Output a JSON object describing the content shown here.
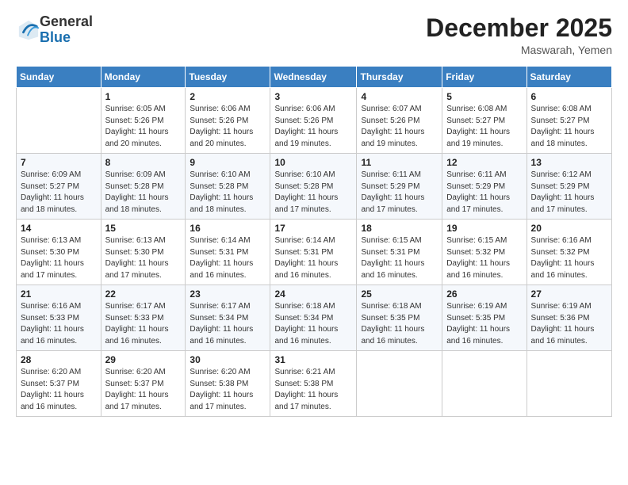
{
  "logo": {
    "line1": "General",
    "line2": "Blue"
  },
  "title": "December 2025",
  "location": "Maswarah, Yemen",
  "days_of_week": [
    "Sunday",
    "Monday",
    "Tuesday",
    "Wednesday",
    "Thursday",
    "Friday",
    "Saturday"
  ],
  "weeks": [
    [
      {
        "day": "",
        "info": ""
      },
      {
        "day": "1",
        "info": "Sunrise: 6:05 AM\nSunset: 5:26 PM\nDaylight: 11 hours\nand 20 minutes."
      },
      {
        "day": "2",
        "info": "Sunrise: 6:06 AM\nSunset: 5:26 PM\nDaylight: 11 hours\nand 20 minutes."
      },
      {
        "day": "3",
        "info": "Sunrise: 6:06 AM\nSunset: 5:26 PM\nDaylight: 11 hours\nand 19 minutes."
      },
      {
        "day": "4",
        "info": "Sunrise: 6:07 AM\nSunset: 5:26 PM\nDaylight: 11 hours\nand 19 minutes."
      },
      {
        "day": "5",
        "info": "Sunrise: 6:08 AM\nSunset: 5:27 PM\nDaylight: 11 hours\nand 19 minutes."
      },
      {
        "day": "6",
        "info": "Sunrise: 6:08 AM\nSunset: 5:27 PM\nDaylight: 11 hours\nand 18 minutes."
      }
    ],
    [
      {
        "day": "7",
        "info": "Sunrise: 6:09 AM\nSunset: 5:27 PM\nDaylight: 11 hours\nand 18 minutes."
      },
      {
        "day": "8",
        "info": "Sunrise: 6:09 AM\nSunset: 5:28 PM\nDaylight: 11 hours\nand 18 minutes."
      },
      {
        "day": "9",
        "info": "Sunrise: 6:10 AM\nSunset: 5:28 PM\nDaylight: 11 hours\nand 18 minutes."
      },
      {
        "day": "10",
        "info": "Sunrise: 6:10 AM\nSunset: 5:28 PM\nDaylight: 11 hours\nand 17 minutes."
      },
      {
        "day": "11",
        "info": "Sunrise: 6:11 AM\nSunset: 5:29 PM\nDaylight: 11 hours\nand 17 minutes."
      },
      {
        "day": "12",
        "info": "Sunrise: 6:11 AM\nSunset: 5:29 PM\nDaylight: 11 hours\nand 17 minutes."
      },
      {
        "day": "13",
        "info": "Sunrise: 6:12 AM\nSunset: 5:29 PM\nDaylight: 11 hours\nand 17 minutes."
      }
    ],
    [
      {
        "day": "14",
        "info": "Sunrise: 6:13 AM\nSunset: 5:30 PM\nDaylight: 11 hours\nand 17 minutes."
      },
      {
        "day": "15",
        "info": "Sunrise: 6:13 AM\nSunset: 5:30 PM\nDaylight: 11 hours\nand 17 minutes."
      },
      {
        "day": "16",
        "info": "Sunrise: 6:14 AM\nSunset: 5:31 PM\nDaylight: 11 hours\nand 16 minutes."
      },
      {
        "day": "17",
        "info": "Sunrise: 6:14 AM\nSunset: 5:31 PM\nDaylight: 11 hours\nand 16 minutes."
      },
      {
        "day": "18",
        "info": "Sunrise: 6:15 AM\nSunset: 5:31 PM\nDaylight: 11 hours\nand 16 minutes."
      },
      {
        "day": "19",
        "info": "Sunrise: 6:15 AM\nSunset: 5:32 PM\nDaylight: 11 hours\nand 16 minutes."
      },
      {
        "day": "20",
        "info": "Sunrise: 6:16 AM\nSunset: 5:32 PM\nDaylight: 11 hours\nand 16 minutes."
      }
    ],
    [
      {
        "day": "21",
        "info": "Sunrise: 6:16 AM\nSunset: 5:33 PM\nDaylight: 11 hours\nand 16 minutes."
      },
      {
        "day": "22",
        "info": "Sunrise: 6:17 AM\nSunset: 5:33 PM\nDaylight: 11 hours\nand 16 minutes."
      },
      {
        "day": "23",
        "info": "Sunrise: 6:17 AM\nSunset: 5:34 PM\nDaylight: 11 hours\nand 16 minutes."
      },
      {
        "day": "24",
        "info": "Sunrise: 6:18 AM\nSunset: 5:34 PM\nDaylight: 11 hours\nand 16 minutes."
      },
      {
        "day": "25",
        "info": "Sunrise: 6:18 AM\nSunset: 5:35 PM\nDaylight: 11 hours\nand 16 minutes."
      },
      {
        "day": "26",
        "info": "Sunrise: 6:19 AM\nSunset: 5:35 PM\nDaylight: 11 hours\nand 16 minutes."
      },
      {
        "day": "27",
        "info": "Sunrise: 6:19 AM\nSunset: 5:36 PM\nDaylight: 11 hours\nand 16 minutes."
      }
    ],
    [
      {
        "day": "28",
        "info": "Sunrise: 6:20 AM\nSunset: 5:37 PM\nDaylight: 11 hours\nand 16 minutes."
      },
      {
        "day": "29",
        "info": "Sunrise: 6:20 AM\nSunset: 5:37 PM\nDaylight: 11 hours\nand 17 minutes."
      },
      {
        "day": "30",
        "info": "Sunrise: 6:20 AM\nSunset: 5:38 PM\nDaylight: 11 hours\nand 17 minutes."
      },
      {
        "day": "31",
        "info": "Sunrise: 6:21 AM\nSunset: 5:38 PM\nDaylight: 11 hours\nand 17 minutes."
      },
      {
        "day": "",
        "info": ""
      },
      {
        "day": "",
        "info": ""
      },
      {
        "day": "",
        "info": ""
      }
    ]
  ]
}
